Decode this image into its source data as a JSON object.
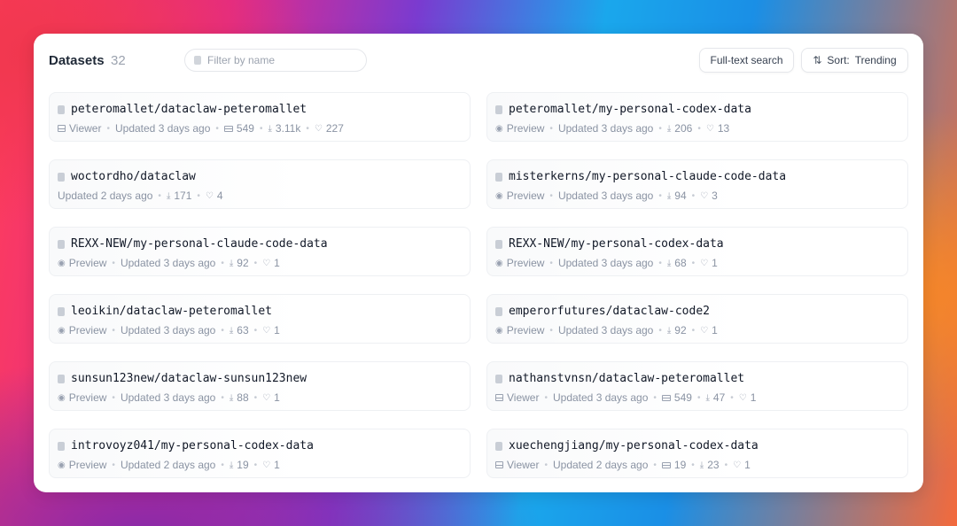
{
  "header": {
    "title": "Datasets",
    "count": "32",
    "filter_placeholder": "Filter by name",
    "fulltext_label": "Full-text search",
    "sort_label": "Sort:",
    "sort_value": "Trending"
  },
  "datasets": [
    {
      "name": "peteromallet/dataclaw-peteromallet",
      "mode": "Viewer",
      "updated": "Updated 3 days ago",
      "rows": "549",
      "downloads": "3.11k",
      "likes": "227"
    },
    {
      "name": "peteromallet/my-personal-codex-data",
      "mode": "Preview",
      "updated": "Updated 3 days ago",
      "rows": null,
      "downloads": "206",
      "likes": "13"
    },
    {
      "name": "woctordho/dataclaw",
      "mode": null,
      "updated": "Updated 2 days ago",
      "rows": null,
      "downloads": "171",
      "likes": "4"
    },
    {
      "name": "misterkerns/my-personal-claude-code-data",
      "mode": "Preview",
      "updated": "Updated 3 days ago",
      "rows": null,
      "downloads": "94",
      "likes": "3"
    },
    {
      "name": "REXX-NEW/my-personal-claude-code-data",
      "mode": "Preview",
      "updated": "Updated 3 days ago",
      "rows": null,
      "downloads": "92",
      "likes": "1"
    },
    {
      "name": "REXX-NEW/my-personal-codex-data",
      "mode": "Preview",
      "updated": "Updated 3 days ago",
      "rows": null,
      "downloads": "68",
      "likes": "1"
    },
    {
      "name": "leoikin/dataclaw-peteromallet",
      "mode": "Preview",
      "updated": "Updated 3 days ago",
      "rows": null,
      "downloads": "63",
      "likes": "1"
    },
    {
      "name": "emperorfutures/dataclaw-code2",
      "mode": "Preview",
      "updated": "Updated 3 days ago",
      "rows": null,
      "downloads": "92",
      "likes": "1"
    },
    {
      "name": "sunsun123new/dataclaw-sunsun123new",
      "mode": "Preview",
      "updated": "Updated 3 days ago",
      "rows": null,
      "downloads": "88",
      "likes": "1"
    },
    {
      "name": "nathanstvnsn/dataclaw-peteromallet",
      "mode": "Viewer",
      "updated": "Updated 3 days ago",
      "rows": "549",
      "downloads": "47",
      "likes": "1"
    },
    {
      "name": "introvoyz041/my-personal-codex-data",
      "mode": "Preview",
      "updated": "Updated 2 days ago",
      "rows": null,
      "downloads": "19",
      "likes": "1"
    },
    {
      "name": "xuechengjiang/my-personal-codex-data",
      "mode": "Viewer",
      "updated": "Updated 2 days ago",
      "rows": "19",
      "downloads": "23",
      "likes": "1"
    }
  ]
}
